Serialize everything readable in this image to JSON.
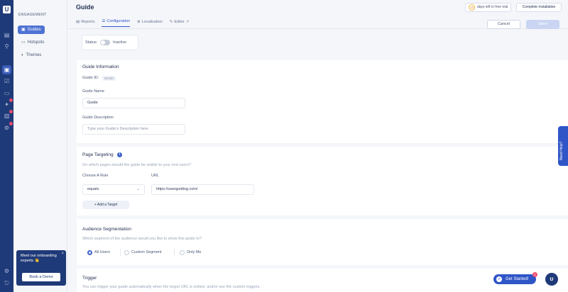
{
  "sidebar": {
    "section": "ENGAGEMENT",
    "items": [
      {
        "label": "Guides",
        "icon": "guides-icon"
      },
      {
        "label": "Hotspots",
        "icon": "hotspot-icon"
      },
      {
        "label": "Themes",
        "icon": "palette-icon"
      }
    ],
    "promo": {
      "text": "Meet our onboarding experts 👋",
      "button": "Book a Demo"
    }
  },
  "header": {
    "title": "Guide",
    "trial_days": "13",
    "trial_text": "days left in free trial",
    "complete_label": "Complete Installation"
  },
  "tabs": [
    {
      "label": "Reports"
    },
    {
      "label": "Configuration"
    },
    {
      "label": "Localization"
    },
    {
      "label": "Editor"
    }
  ],
  "actions": {
    "cancel": "Cancel",
    "save": "Save"
  },
  "status": {
    "label": "Status:",
    "value": "Inactive"
  },
  "guide_info": {
    "heading": "Guide Information",
    "id_label": "Guide ID:",
    "id_value": "N/A00",
    "name_label": "Guide Name",
    "name_value": "Guide",
    "desc_label": "Guide Description",
    "desc_placeholder": "Type your Guide's Description here"
  },
  "page_targeting": {
    "heading": "Page Targeting",
    "sub": "On which pages should the guide be visible to your end users?",
    "rule_label": "Choose A Rule",
    "url_label": "URL",
    "rule_value": "equals",
    "url_value": "https://userguiding.com/",
    "add_target": "+ Add a Target"
  },
  "audience": {
    "heading": "Audience Segmentation",
    "sub": "Which segment of the audience would you like to show this guide to?",
    "options": [
      "All Users",
      "Custom Segment",
      "Only Me"
    ]
  },
  "trigger": {
    "heading": "Trigger",
    "sub": "You can trigger your guide automatically when the target URL is visited, and/or use the custom triggers."
  },
  "help": {
    "need_help": "Need Help?",
    "get_started": "Get Started!",
    "notif_count": "1"
  }
}
